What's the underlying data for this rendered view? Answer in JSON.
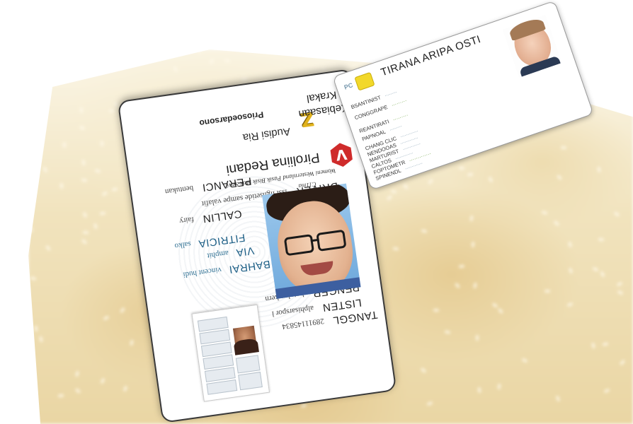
{
  "scene": {
    "description_free": true
  },
  "main_card": {
    "rows": [
      {
        "label": "DRIVER",
        "value": "issi lighsetide sampe valafit"
      },
      {
        "label": "PERANCI",
        "value": "bentukan"
      },
      {
        "label": "CALLIN",
        "value": "fairy"
      },
      {
        "label": "FITRICIA",
        "value": "salko"
      },
      {
        "label": "VIA",
        "value": "amphit"
      },
      {
        "label": "BAHRAI",
        "value": "vincent hudi"
      },
      {
        "label": "PENGER",
        "value": "hotolan kern"
      },
      {
        "label": "LISTEN",
        "value": "alphisarspor l"
      },
      {
        "label": "TANGGL",
        "value": "28911145834"
      },
      {
        "label": "C11ma",
        "value": ""
      }
    ],
    "fine_print": "Womeni Westernland Pasik Bisik Mok Sewi",
    "name": "Piroliina Redani",
    "subname": "Audisi Ria",
    "footer_label": "Priosoedarsono",
    "footer_name_line1": "Kebiasaan",
    "footer_name_line2": "Krakal",
    "logo_letter": "V",
    "logo_z": "Z"
  },
  "tr_card": {
    "brand": "PC",
    "title": "TIRANA ARIPA OSTI",
    "rows": [
      {
        "label": "BSANTINIST",
        "value": ""
      },
      {
        "label": "CONGGRAPE",
        "value": ""
      },
      {
        "label": "REANTIRATI",
        "value": ""
      },
      {
        "label": "PAPNOAL",
        "value": ""
      },
      {
        "label": "CHANG CLIC",
        "value": ""
      },
      {
        "label": "NENDOOAS",
        "value": ""
      },
      {
        "label": "MARTURIST",
        "value": ""
      },
      {
        "label": "CALTOS",
        "value": ""
      },
      {
        "label": "FOPTOMETR",
        "value": ""
      },
      {
        "label": "SPINENDL",
        "value": ""
      }
    ]
  },
  "colors": {
    "card_border": "#3a3a3a",
    "logo_red": "#cf2b2b",
    "label_blue": "#1d5f86",
    "chip_yellow": "#f2d82a",
    "rice_tone": "#ead6a4"
  }
}
